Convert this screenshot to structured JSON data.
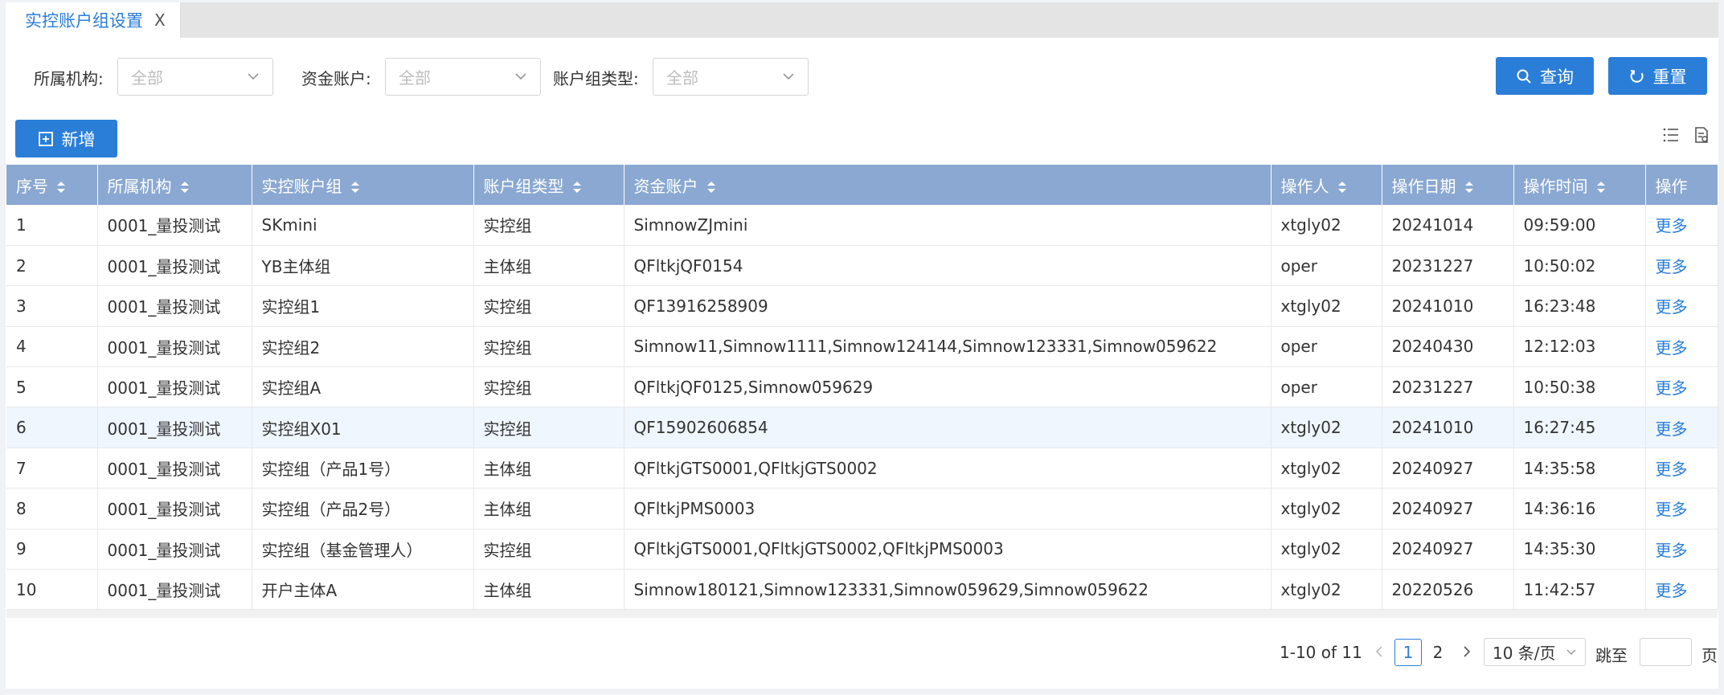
{
  "tab": {
    "title": "实控账户组设置",
    "close": "X"
  },
  "filters": {
    "org_label": "所属机构:",
    "org_value": "全部",
    "account_label": "资金账户:",
    "account_value": "全部",
    "group_type_label": "账户组类型:",
    "group_type_value": "全部"
  },
  "buttons": {
    "query": "查询",
    "reset": "重置",
    "add": "新增"
  },
  "table": {
    "columns": [
      "序号",
      "所属机构",
      "实控账户组",
      "账户组类型",
      "资金账户",
      "操作人",
      "操作日期",
      "操作时间",
      "操作"
    ],
    "rows": [
      [
        "1",
        "0001_量投测试",
        "SKmini",
        "实控组",
        "SimnowZJmini",
        "xtgly02",
        "20241014",
        "09:59:00",
        "更多"
      ],
      [
        "2",
        "0001_量投测试",
        "YB主体组",
        "主体组",
        "QFltkjQF0154",
        "oper",
        "20231227",
        "10:50:02",
        "更多"
      ],
      [
        "3",
        "0001_量投测试",
        "实控组1",
        "实控组",
        "QF13916258909",
        "xtgly02",
        "20241010",
        "16:23:48",
        "更多"
      ],
      [
        "4",
        "0001_量投测试",
        "实控组2",
        "实控组",
        "Simnow11,Simnow1111,Simnow124144,Simnow123331,Simnow059622",
        "oper",
        "20240430",
        "12:12:03",
        "更多"
      ],
      [
        "5",
        "0001_量投测试",
        "实控组A",
        "实控组",
        "QFltkjQF0125,Simnow059629",
        "oper",
        "20231227",
        "10:50:38",
        "更多"
      ],
      [
        "6",
        "0001_量投测试",
        "实控组X01",
        "实控组",
        "QF15902606854",
        "xtgly02",
        "20241010",
        "16:27:45",
        "更多"
      ],
      [
        "7",
        "0001_量投测试",
        "实控组（产品1号）",
        "主体组",
        "QFltkjGTS0001,QFltkjGTS0002",
        "xtgly02",
        "20240927",
        "14:35:58",
        "更多"
      ],
      [
        "8",
        "0001_量投测试",
        "实控组（产品2号）",
        "主体组",
        "QFltkjPMS0003",
        "xtgly02",
        "20240927",
        "14:36:16",
        "更多"
      ],
      [
        "9",
        "0001_量投测试",
        "实控组（基金管理人）",
        "实控组",
        "QFltkjGTS0001,QFltkjGTS0002,QFltkjPMS0003",
        "xtgly02",
        "20240927",
        "14:35:30",
        "更多"
      ],
      [
        "10",
        "0001_量投测试",
        "开户主体A",
        "主体组",
        "Simnow180121,Simnow123331,Simnow059629,Simnow059622",
        "xtgly02",
        "20220526",
        "11:42:57",
        "更多"
      ]
    ]
  },
  "pagination": {
    "summary": "1-10 of 11",
    "pages": [
      "1",
      "2"
    ],
    "page_size": "10 条/页",
    "jump_label": "跳至",
    "page_suffix": "页"
  },
  "colors": {
    "accent": "#2a7ed8",
    "header_bg": "#8aa8d1",
    "highlight_row": "#eff6fd"
  }
}
